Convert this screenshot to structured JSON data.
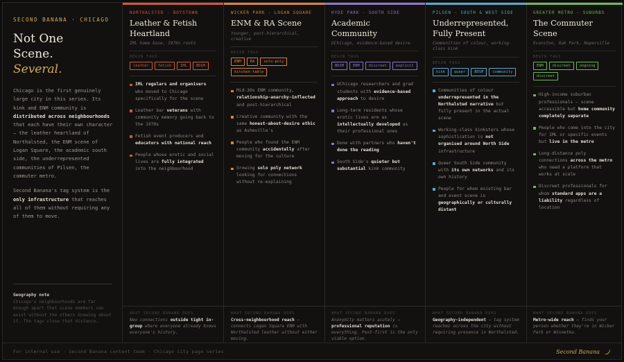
{
  "kicker": "SECOND BANANA · CHICAGO",
  "hero": {
    "line1": "Not One",
    "line2": "Scene.",
    "accent": "Several."
  },
  "intro": {
    "p1a": "Chicago is the first genuinely large city in this series. Its kink and ENM community is ",
    "p1b": "distributed across neighbourhoods",
    "p1c": " that each have their own character — the leather heartland of Northalsted, the ENM scene of Logan Square, the academic south side, the underrepresented communities of Pilsen, the commuter metro.",
    "p2a": "Second Banana's tag system is the ",
    "p2b": "only infrastructure",
    "p2c": " that reaches all of them without requiring any of them to move."
  },
  "geo": {
    "heading": "Geography note",
    "text": "Chicago's neighbourhoods are far enough apart that scene members can exist without the others knowing about it. The tags close that distance."
  },
  "tag_label": "BEGIN TAGS",
  "footer_label": "WHAT SECOND BANANA DOES",
  "columns": [
    {
      "color": "#d0583f",
      "eyebrow": "NORTHALSTED · BOYSTOWN",
      "title": "Leather & Fetish Heartland",
      "subtitle": "IML home base, 1970s roots",
      "tags": [
        "leather",
        "fetish",
        "IML",
        "BDSM"
      ],
      "items": [
        {
          "a": "",
          "b": "IML regulars and organisers",
          "c": " who moved to Chicago specifically for the scene"
        },
        {
          "a": "Leather bar ",
          "b": "veterans",
          "c": " with community memory going back to the 1970s"
        },
        {
          "a": "Fetish event producers and ",
          "b": "educators with national reach",
          "c": ""
        },
        {
          "a": "People whose erotic and social lives are ",
          "b": "fully integrated",
          "c": " into the neighbourhood"
        }
      ],
      "foot": {
        "a": "New connections ",
        "b": "outside tight in-group",
        "c": " where everyone already knows everyone's history."
      }
    },
    {
      "color": "#d8843c",
      "eyebrow": "WICKER PARK · LOGAN SQUARE",
      "title": "ENM & RA Scene",
      "subtitle": "Younger, post-hierarchical, creative",
      "tags": [
        "ENM",
        "RA",
        "solo-poly",
        "kitchen-table"
      ],
      "items": [
        {
          "a": "Mid-30s ENM community, ",
          "b": "relationship-anarchy-inflected",
          "c": " and post-hierarchical"
        },
        {
          "a": "Creative community with the same ",
          "b": "honest-about-desire ethic",
          "c": " as Asheville's"
        },
        {
          "a": "People who found the ENM community ",
          "b": "accidentally",
          "c": " after moving for the culture"
        },
        {
          "a": "Growing ",
          "b": "solo poly network",
          "c": " looking for connections without re-explaining"
        }
      ],
      "foot": {
        "a": "",
        "b": "Cross-neighbourhood reach",
        "c": " — connects Logan Square ENM with Northalsted leather without either moving."
      }
    },
    {
      "color": "#8b76c8",
      "eyebrow": "HYDE PARK · SOUTH SIDE",
      "title": "Academic Community",
      "subtitle": "UChicago, evidence-based desire",
      "tags": [
        "BDSM",
        "ENM",
        "discreet",
        "explicit"
      ],
      "items": [
        {
          "a": "UChicago researchers and grad students with ",
          "b": "evidence-based approach",
          "c": " to desire"
        },
        {
          "a": "Long-term residents whose erotic lives are as ",
          "b": "intellectually developed",
          "c": " as their professional ones"
        },
        {
          "a": "Done with partners who ",
          "b": "haven't done the reading",
          "c": ""
        },
        {
          "a": "South Side's ",
          "b": "quieter but substantial",
          "c": " kink community"
        }
      ],
      "foot": {
        "a": "Anonymity matters acutely — ",
        "b": "professional reputation",
        "c": " is everything. Post-first is the only viable option."
      }
    },
    {
      "color": "#5aa8d0",
      "eyebrow": "PILSEN · SOUTH & WEST SIDE",
      "title": "Underrepresented, Fully Present",
      "subtitle": "Communities of colour, working-class kink",
      "tags": [
        "kink",
        "queer",
        "BDSM",
        "community"
      ],
      "items": [
        {
          "a": "Communities of colour ",
          "b": "underrepresented in the Northalsted narrative",
          "c": " but fully present in the actual scene"
        },
        {
          "a": "Working-class kinksters whose sophistication is ",
          "b": "not organised around North Side",
          "c": " infrastructure"
        },
        {
          "a": "Queer South Side community with ",
          "b": "its own networks",
          "c": " and its own history"
        },
        {
          "a": "People for whom existing bar and event scene is ",
          "b": "geographically or culturally distant",
          "c": ""
        }
      ],
      "foot": {
        "a": "",
        "b": "Geography-independent",
        "c": " — tag system reaches across the city without requiring presence in Northalsted."
      }
    },
    {
      "color": "#6fb85a",
      "eyebrow": "GREATER METRO · SUBURBS",
      "title": "The Commuter Scene",
      "subtitle": "Evanston, Oak Park, Naperville",
      "tags": [
        "ENM",
        "discreet",
        "ongoing",
        "discreet"
      ],
      "items": [
        {
          "a": "High-income suburban professionals — scene accessible but ",
          "b": "home community completely separate",
          "c": ""
        },
        {
          "a": "People who come into the city for IML or specific events but ",
          "b": "live in the metro",
          "c": ""
        },
        {
          "a": "Long-distance poly connections ",
          "b": "across the metro",
          "c": " who need a platform that works at scale"
        },
        {
          "a": "Discreet professionals for whom ",
          "b": "standard apps are a liability",
          "c": " regardless of location"
        }
      ],
      "foot": {
        "a": "",
        "b": "Metro-wide reach",
        "c": " — finds your person whether they're in Wicker Park or Winnetka."
      }
    }
  ],
  "footer_note": "For internal use · Second Banana content team · Chicago city page series",
  "brand": "Second Banana"
}
